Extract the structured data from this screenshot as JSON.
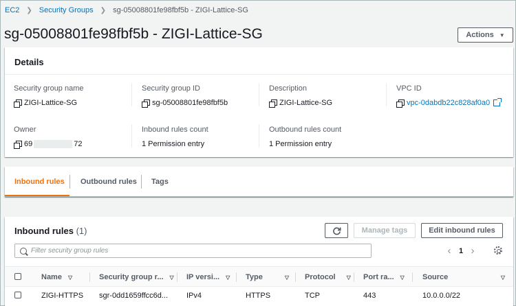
{
  "breadcrumb": {
    "ec2": "EC2",
    "security_groups": "Security Groups",
    "current": "sg-05008801fe98fbf5b - ZIGI-Lattice-SG"
  },
  "page_title": "sg-05008801fe98fbf5b - ZIGI-Lattice-SG",
  "actions_button": {
    "label": "Actions",
    "icon": "caret-down-icon"
  },
  "details": {
    "heading": "Details",
    "fields": {
      "sg_name": {
        "label": "Security group name",
        "value": "ZIGI-Lattice-SG"
      },
      "sg_id": {
        "label": "Security group ID",
        "value": "sg-05008801fe98fbf5b"
      },
      "description": {
        "label": "Description",
        "value": "ZIGI-Lattice-SG"
      },
      "vpc_id": {
        "label": "VPC ID",
        "value": "vpc-0dabdb22c828af0a0"
      },
      "owner": {
        "label": "Owner",
        "value_prefix": "69",
        "value_suffix": "72"
      },
      "inbound_count": {
        "label": "Inbound rules count",
        "value": "1 Permission entry"
      },
      "outbound_count": {
        "label": "Outbound rules count",
        "value": "1 Permission entry"
      }
    }
  },
  "tabs": [
    {
      "label": "Inbound rules",
      "active": true
    },
    {
      "label": "Outbound rules",
      "active": false
    },
    {
      "label": "Tags",
      "active": false
    }
  ],
  "inbound_rules": {
    "title": "Inbound rules",
    "count": "(1)",
    "refresh_icon": "refresh-icon",
    "manage_tags_label": "Manage tags",
    "edit_label": "Edit inbound rules",
    "search_placeholder": "Filter security group rules",
    "page": "1",
    "columns": [
      "Name",
      "Security group r...",
      "IP versi...",
      "Type",
      "Protocol",
      "Port ra...",
      "Source"
    ],
    "rows": [
      {
        "name": "ZIGI-HTTPS",
        "sg_rule_id": "sgr-0dd1659ffcc6d...",
        "ip_version": "IPv4",
        "type": "HTTPS",
        "protocol": "TCP",
        "port_range": "443",
        "source": "10.0.0.0/22"
      }
    ]
  },
  "colors": {
    "link": "#0073bb",
    "active_tab": "#ec7211",
    "text": "#16191f",
    "muted": "#545b64"
  }
}
